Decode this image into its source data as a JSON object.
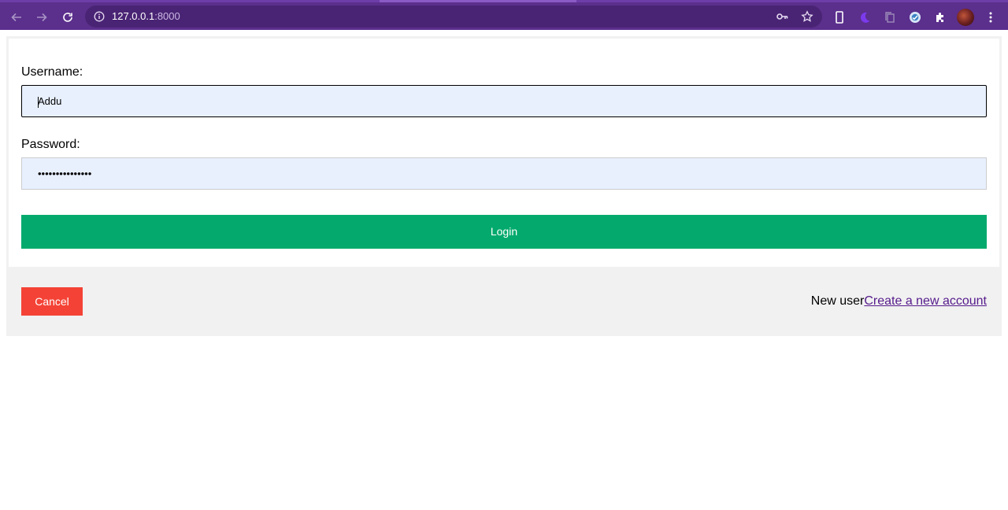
{
  "browser": {
    "url_host": "127.0.0.1",
    "url_port": ":8000",
    "colors": {
      "chrome": "#5b2f8c",
      "omnibox": "#4a2474"
    }
  },
  "form": {
    "username_label": "Username:",
    "username_value": "Addu",
    "password_label": "Password:",
    "password_value": "•••••••••••••••",
    "login_label": "Login"
  },
  "footer": {
    "cancel_label": "Cancel",
    "new_user_text": "New user",
    "create_account_link": "Create a new account"
  },
  "colors": {
    "login_button": "#04aa6d",
    "cancel_button": "#f44336",
    "input_background": "#e8f0fe",
    "footer_background": "#f1f1f1",
    "link": "#551a8b"
  },
  "icons": [
    "back-arrow-icon",
    "forward-arrow-icon",
    "reload-icon",
    "info-icon",
    "key-icon",
    "star-icon",
    "phone-icon",
    "moon-icon",
    "copy-icon",
    "extension-circle-icon",
    "puzzle-icon",
    "avatar",
    "kebab-menu-icon"
  ]
}
